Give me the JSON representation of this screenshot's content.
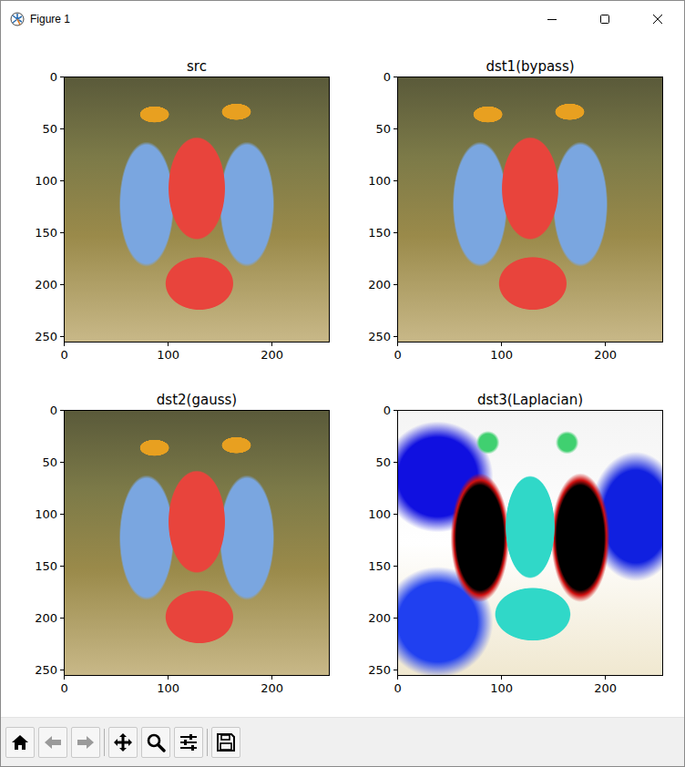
{
  "window": {
    "title": "Figure 1",
    "controls": [
      {
        "kind": "minimize"
      },
      {
        "kind": "maximize"
      },
      {
        "kind": "close"
      }
    ]
  },
  "plots": [
    {
      "title": "src",
      "xticks": [
        "0",
        "100",
        "200"
      ],
      "yticks": [
        "0",
        "50",
        "100",
        "150",
        "200",
        "250"
      ]
    },
    {
      "title": "dst1(bypass)",
      "xticks": [
        "0",
        "100",
        "200"
      ],
      "yticks": [
        "0",
        "50",
        "100",
        "150",
        "200",
        "250"
      ]
    },
    {
      "title": "dst2(gauss)",
      "xticks": [
        "0",
        "100",
        "200"
      ],
      "yticks": [
        "0",
        "50",
        "100",
        "150",
        "200",
        "250"
      ]
    },
    {
      "title": "dst3(Laplacian)",
      "xticks": [
        "0",
        "100",
        "200"
      ],
      "yticks": [
        "0",
        "50",
        "100",
        "150",
        "200",
        "250"
      ]
    }
  ],
  "toolbar": {
    "groups": [
      [
        {
          "kind": "home",
          "disabled": false
        },
        {
          "kind": "back",
          "disabled": true
        },
        {
          "kind": "forward",
          "disabled": true
        }
      ],
      [
        {
          "kind": "pan",
          "disabled": false
        },
        {
          "kind": "zoom",
          "disabled": false
        },
        {
          "kind": "configure",
          "disabled": false
        }
      ],
      [
        {
          "kind": "save",
          "disabled": false
        }
      ]
    ]
  }
}
